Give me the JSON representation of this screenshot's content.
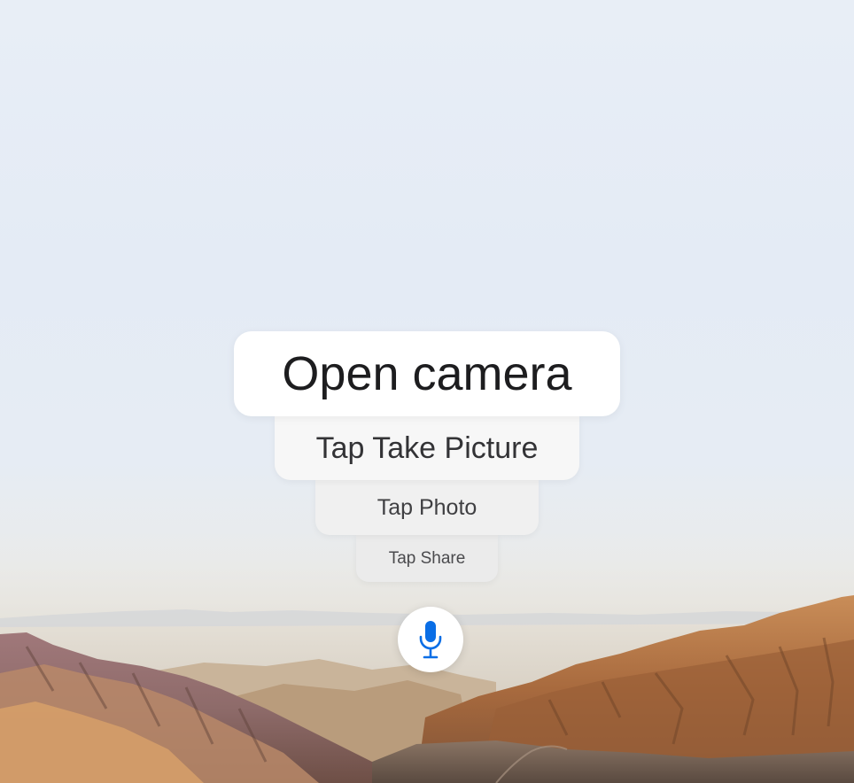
{
  "voice_commands": [
    {
      "label": "Open camera"
    },
    {
      "label": "Tap Take Picture"
    },
    {
      "label": "Tap Photo"
    },
    {
      "label": "Tap Share"
    }
  ],
  "mic_button": {
    "icon": "microphone-icon",
    "color": "#0a6ee6"
  },
  "background": {
    "sky_color": "#e6ecf5"
  }
}
